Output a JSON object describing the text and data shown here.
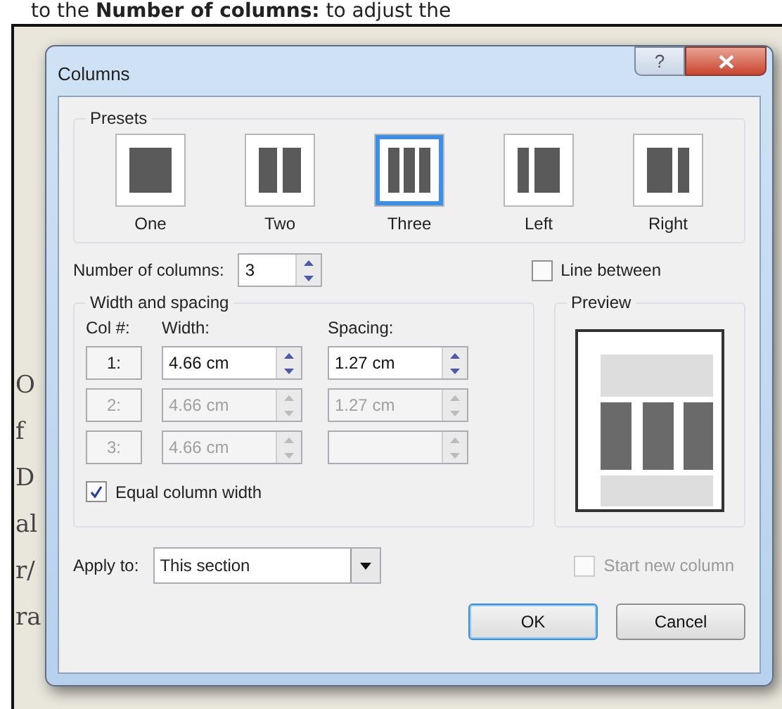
{
  "page": {
    "intro": "to the **Number of columns:** to adjust the",
    "lines": [
      {
        "left": "O"
      },
      {
        "left": "f"
      },
      {
        "left": "D"
      },
      {
        "left": "al"
      },
      {
        "left": "r/"
      },
      {
        "left": "ra"
      }
    ]
  },
  "dialog": {
    "title": "Columns",
    "help": "?",
    "presets": {
      "title": "Presets",
      "items": [
        {
          "label": "One",
          "kind": "one",
          "selected": false
        },
        {
          "label": "Two",
          "kind": "two",
          "selected": false
        },
        {
          "label": "Three",
          "kind": "three",
          "selected": true
        },
        {
          "label": "Left",
          "kind": "left",
          "selected": false
        },
        {
          "label": "Right",
          "kind": "right",
          "selected": false
        }
      ]
    },
    "number_of_columns": {
      "label": "Number of columns:",
      "value": "3"
    },
    "line_between": {
      "label": "Line between",
      "checked": false
    },
    "width_spacing": {
      "title": "Width and spacing",
      "headers": [
        "Col #:",
        "Width:",
        "Spacing:"
      ],
      "rows": [
        {
          "col": "1:",
          "width": "4.66 cm",
          "spacing": "1.27 cm",
          "disabled": false
        },
        {
          "col": "2:",
          "width": "4.66 cm",
          "spacing": "1.27 cm",
          "disabled": true
        },
        {
          "col": "3:",
          "width": "4.66 cm",
          "disabled": true
        }
      ]
    },
    "equal_width": {
      "label": "Equal column width",
      "checked": true
    },
    "preview": {
      "title": "Preview"
    },
    "apply_to": {
      "label": "Apply to:",
      "value": "This section"
    },
    "start_new_column": {
      "label": "Start new column",
      "checked": false,
      "disabled": true
    },
    "buttons": [
      {
        "label": "OK",
        "default": true
      },
      {
        "label": "Cancel",
        "default": false
      }
    ]
  }
}
